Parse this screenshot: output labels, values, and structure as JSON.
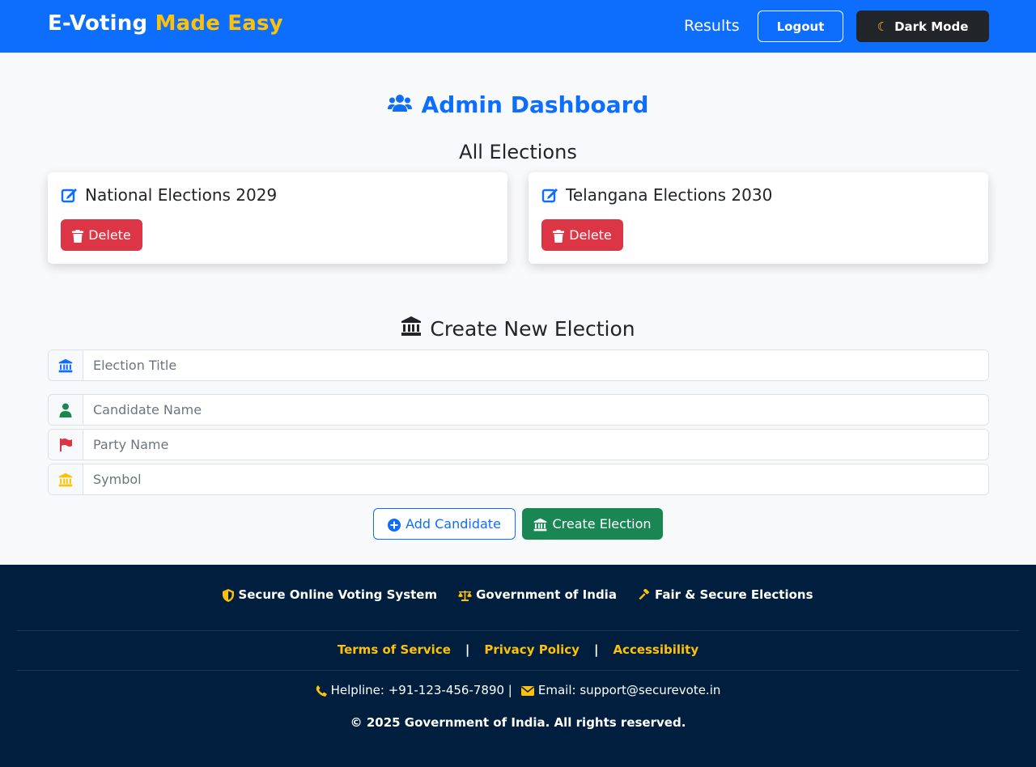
{
  "navbar": {
    "brand_primary": "E-Voting",
    "brand_accent": "Made Easy",
    "results_link": "Results",
    "logout_label": "Logout",
    "dark_mode_label": "Dark Mode"
  },
  "dashboard": {
    "title": "Admin Dashboard",
    "elections_heading": "All Elections",
    "elections": [
      {
        "name": "National Elections 2029",
        "delete_label": "Delete"
      },
      {
        "name": "Telangana Elections 2030",
        "delete_label": "Delete"
      }
    ]
  },
  "create_election": {
    "heading": "Create New Election",
    "title_placeholder": "Election Title",
    "candidate_placeholder": "Candidate Name",
    "party_placeholder": "Party Name",
    "symbol_placeholder": "Symbol",
    "add_candidate_label": "Add Candidate",
    "create_label": "Create Election"
  },
  "footer": {
    "tags": [
      "Secure Online Voting System",
      "Government of India",
      "Fair & Secure Elections"
    ],
    "links": [
      "Terms of Service",
      "Privacy Policy",
      "Accessibility"
    ],
    "separator": "|",
    "helpline": "Helpline: +91-123-456-7890 |",
    "email": "Email: support@securevote.in",
    "copyright": "© 2025 Government of India. All rights reserved."
  },
  "colors": {
    "primary": "#0d6efd",
    "accent": "#ffc107",
    "danger": "#dc3545",
    "success": "#198754",
    "footer_bg": "#001f3f",
    "dark": "#212529"
  },
  "icons": {
    "dark_mode": "moon-icon",
    "dashboard": "users-icon",
    "election_card": "edit-icon",
    "delete": "trash-icon",
    "create_heading": "landmark-icon",
    "title_field": "landmark-icon",
    "candidate_field": "user-icon",
    "party_field": "flag-icon",
    "symbol_field": "landmark-icon",
    "add_candidate": "plus-circle-icon",
    "create_button": "landmark-icon",
    "footer_tags": [
      "shield-icon",
      "scale-icon",
      "gavel-icon"
    ],
    "helpline": "phone-icon",
    "email": "envelope-icon"
  }
}
